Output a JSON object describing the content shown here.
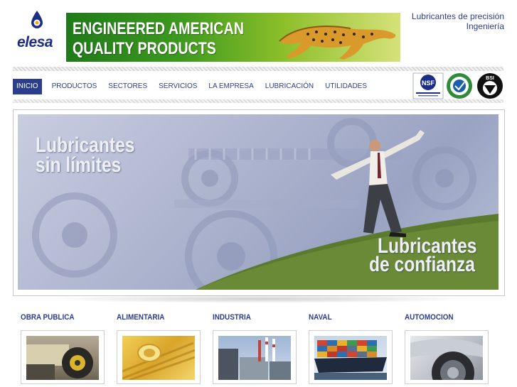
{
  "brand": {
    "logo_text": "elesa",
    "tagline_1": "Lubricantes de precisión",
    "tagline_2": "Ingeniería"
  },
  "banner": {
    "line1": "ENGINEERED AMERICAN",
    "line2": "QUALITY PRODUCTS"
  },
  "nav": {
    "items": [
      {
        "label": "INICIO",
        "active": true
      },
      {
        "label": "PRODUCTOS"
      },
      {
        "label": "SECTORES"
      },
      {
        "label": "SERVICIOS"
      },
      {
        "label": "LA EMPRESA"
      },
      {
        "label": "LUBRICACIÓN"
      },
      {
        "label": "UTILIDADES"
      }
    ]
  },
  "certs": {
    "nsf": "NSF",
    "bsi": "BSI"
  },
  "hero": {
    "text1": "Lubricantes",
    "text2": "sin límites",
    "text3": "Lubricantes",
    "text4": "de confianza"
  },
  "sectors": [
    {
      "title": "OBRA PUBLICA"
    },
    {
      "title": "ALIMENTARIA"
    },
    {
      "title": "INDUSTRIA"
    },
    {
      "title": "NAVAL"
    },
    {
      "title": "AUTOMOCION"
    }
  ],
  "colors": {
    "brand_blue": "#2b3e8e",
    "banner_green": "#3f9a1f"
  }
}
